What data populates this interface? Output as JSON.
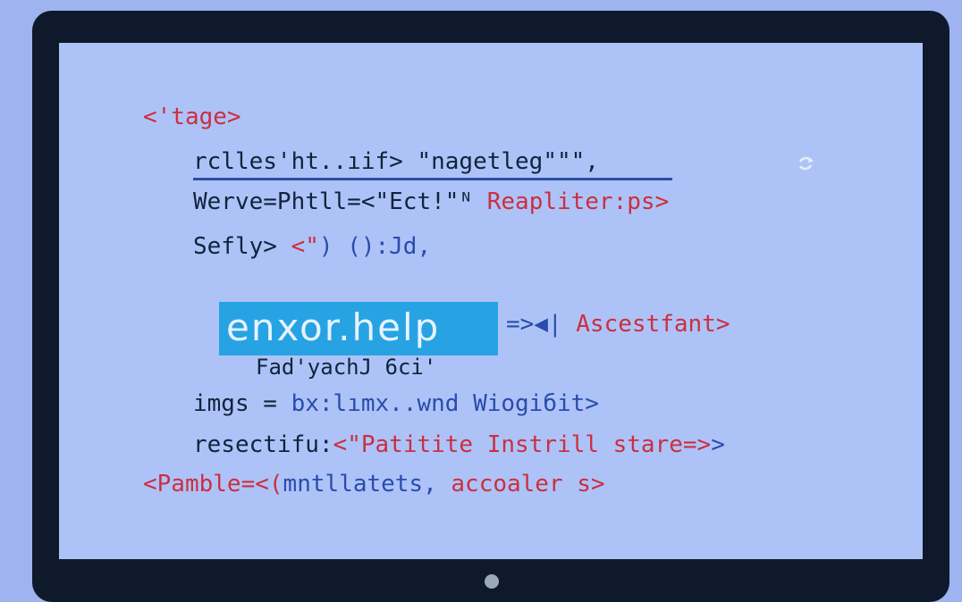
{
  "code_lines": {
    "l1": "<'tage>",
    "l2a": "rclles'ht..ıif> ",
    "l2b": "\"nagetleg\"\"\",",
    "l3a": "Werve=Phtll=<\"Ect!\"ᴺ ",
    "l3b": "Reapliter:ps>",
    "l4a": "Sefly> ",
    "l4b": "<\"",
    "l4c": ") ():Jd,",
    "highlight": "enxor.help",
    "l5b": "=>◀| ",
    "l5c": "Ascestfant>",
    "l6": "Fad'yachJ 6ci'",
    "l7a": "imgs = ",
    "l7b": "bx:lımx..wnd Wiogiбit>",
    "l8a": "resectifu:",
    "l8b": "<\"Patitite Instrill stare=>",
    "l8c": ">",
    "l9a": "<Pamble=<(",
    "l9b": "mntllatets, ",
    "l9c": "accoaler s>"
  },
  "colors": {
    "background": "#9eb3f0",
    "monitor_frame": "#0e1a2b",
    "screen": "#adc3f8",
    "highlight": "#27a3e4",
    "keyword_red": "#cc2f3e",
    "text_dark": "#12233b",
    "text_blue": "#2a4cab"
  },
  "icons": {
    "spinner": "refresh-icon",
    "camera": "webcam-dot-icon"
  }
}
